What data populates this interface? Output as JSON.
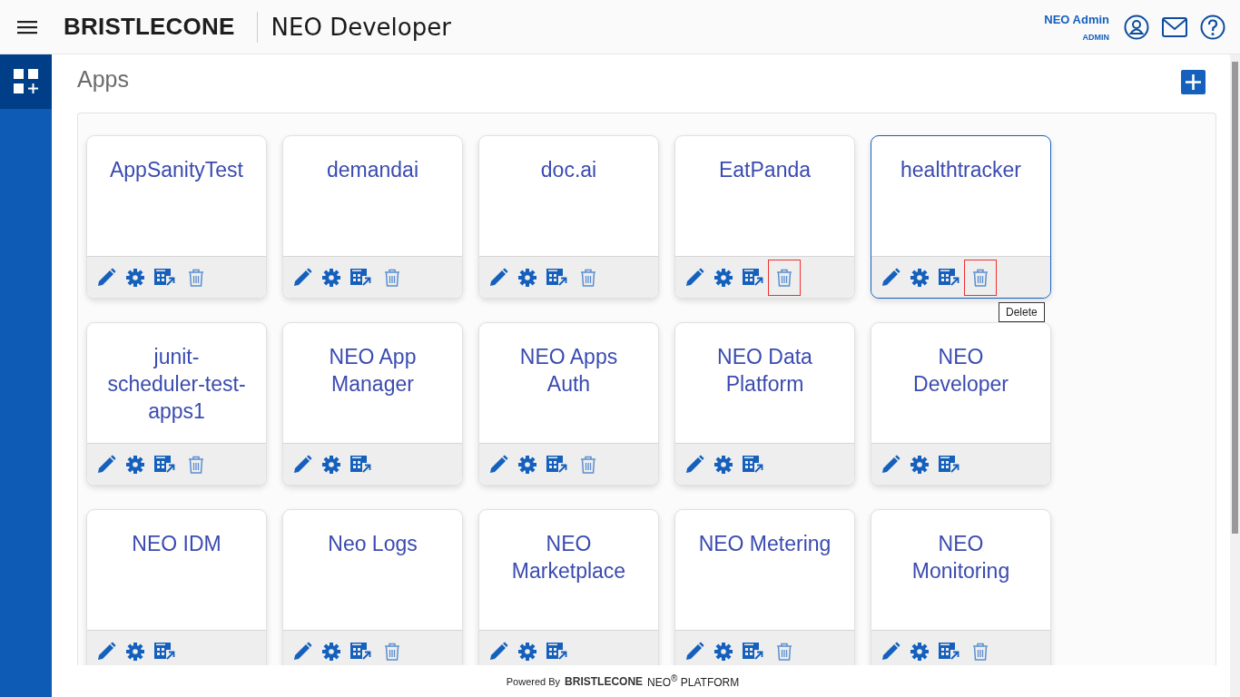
{
  "header": {
    "logo": "BRISTLECONE",
    "app_title": "NEO Developer",
    "user_name": "NEO Admin",
    "user_role": "ADMIN"
  },
  "page_title": "Apps",
  "apps": [
    {
      "name": "AppSanityTest",
      "deletable": true,
      "selected": false,
      "delete_marked": false
    },
    {
      "name": "demandai",
      "deletable": true,
      "selected": false,
      "delete_marked": false
    },
    {
      "name": "doc.ai",
      "deletable": true,
      "selected": false,
      "delete_marked": false
    },
    {
      "name": "EatPanda",
      "deletable": true,
      "selected": false,
      "delete_marked": true
    },
    {
      "name": "healthtracker",
      "deletable": true,
      "selected": true,
      "delete_marked": true,
      "tooltip": "Delete"
    },
    {
      "name": "junit-scheduler-test-apps1",
      "deletable": true,
      "selected": false,
      "delete_marked": false
    },
    {
      "name": "NEO App Manager",
      "deletable": false,
      "selected": false
    },
    {
      "name": "NEO Apps Auth",
      "deletable": true,
      "selected": false,
      "delete_marked": false
    },
    {
      "name": "NEO Data Platform",
      "deletable": false,
      "selected": false
    },
    {
      "name": "NEO Developer",
      "deletable": false,
      "selected": false
    },
    {
      "name": "NEO IDM",
      "deletable": false,
      "selected": false
    },
    {
      "name": "Neo Logs",
      "deletable": true,
      "selected": false,
      "delete_marked": false
    },
    {
      "name": "NEO Marketplace",
      "deletable": false,
      "selected": false
    },
    {
      "name": "NEO Metering",
      "deletable": true,
      "selected": false,
      "delete_marked": false
    },
    {
      "name": "NEO Monitoring",
      "deletable": true,
      "selected": false,
      "delete_marked": false
    }
  ],
  "footer": {
    "powered_by": "Powered By",
    "logo": "BRISTLECONE",
    "product": "NEO$^{®}$ PLATFORM"
  }
}
